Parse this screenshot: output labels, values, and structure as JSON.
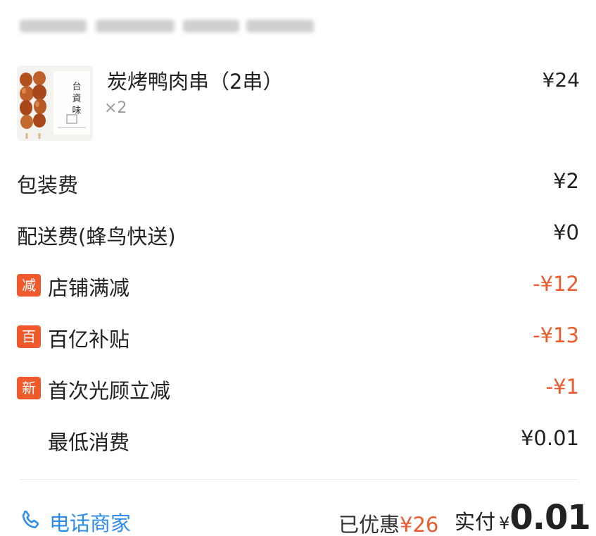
{
  "colors": {
    "discount": "#ef5a2c",
    "link": "#2d8cf0",
    "badge_bg": "#ef5a2c"
  },
  "product": {
    "name": "炭烤鸭肉串（2串）",
    "qty": "×2",
    "price": "¥24",
    "image_icon": "duck-skewer-image",
    "image_text": "台資味"
  },
  "fees": [
    {
      "label": "包装费",
      "amount": "¥2"
    },
    {
      "label": "配送费(蜂鸟快送)",
      "amount": "¥0"
    }
  ],
  "discounts": [
    {
      "badge": "减",
      "label": "店铺满减",
      "amount": "-¥12"
    },
    {
      "badge": "百",
      "label": "百亿补贴",
      "amount": "-¥13"
    },
    {
      "badge": "新",
      "label": "首次光顾立减",
      "amount": "-¥1"
    }
  ],
  "minimum": {
    "label": "最低消费",
    "amount": "¥0.01"
  },
  "footer": {
    "call_label": "电话商家",
    "call_icon": "phone-icon",
    "saved_label": "已优惠",
    "saved_amount": "¥26",
    "paid_label": "实付",
    "paid_currency": "¥",
    "paid_amount": "0.01"
  }
}
